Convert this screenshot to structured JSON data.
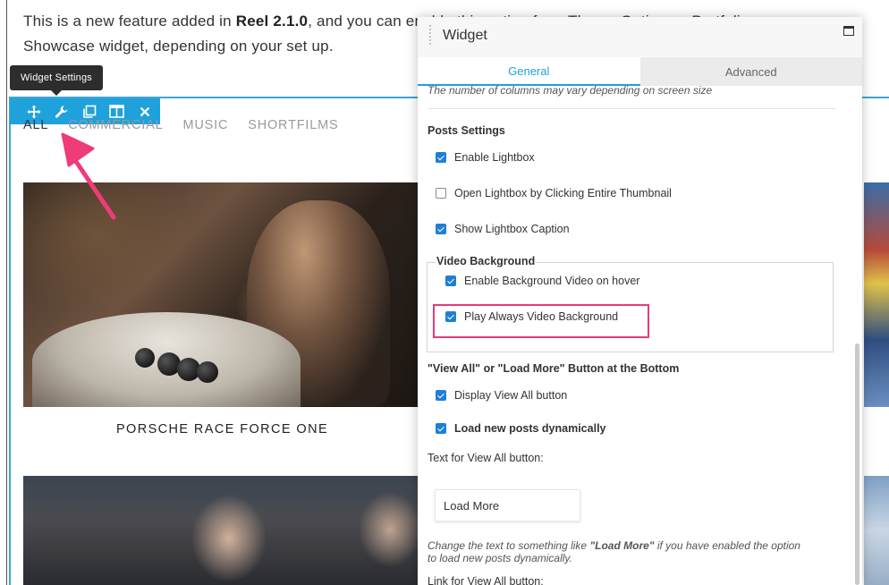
{
  "page": {
    "intro_part1": "This is a new feature added in ",
    "intro_bold": "Reel 2.1.0",
    "intro_part2": ", and you can enable this option from Theme Options » Portfolio",
    "intro_line2": "Showcase widget, depending on your set up."
  },
  "tooltip": "Widget Settings",
  "toolbar": {
    "buttons": [
      "move-icon",
      "wrench-icon",
      "duplicate-icon",
      "columns-icon",
      "close-icon"
    ],
    "accent": "#1fa1dc"
  },
  "filters": [
    "ALL",
    "COMMERCIAL",
    "MUSIC",
    "SHORTFILMS"
  ],
  "portfolio": {
    "caption1": "PORSCHE RACE FORCE ONE"
  },
  "panel": {
    "title": "Widget",
    "tabs": [
      "General",
      "Advanced"
    ],
    "columns_note": "The number of columns may vary depending on screen size",
    "posts_settings": {
      "heading": "Posts Settings",
      "enable_lightbox": "Enable Lightbox",
      "open_lightbox": "Open Lightbox by Clicking Entire Thumbnail",
      "show_caption": "Show Lightbox Caption"
    },
    "video_background": {
      "legend": "Video Background",
      "enable_hover": "Enable Background Video on hover",
      "play_always": "Play Always Video Background"
    },
    "view_all": {
      "heading": "\"View All\" or \"Load More\" Button at the Bottom",
      "display_button": "Display View All button",
      "load_dynamic": "Load new posts dynamically",
      "text_label": "Text for View All button:",
      "text_value": "Load More",
      "hint_part1": "Change the text to something like ",
      "hint_bold": "\"Load More\"",
      "hint_part2": " if you have enabled the option",
      "hint_line2": "to load new posts dynamically.",
      "link_label": "Link for View All button:"
    }
  },
  "colors": {
    "highlight": "#e33d77",
    "arrow": "#ef3b78",
    "checkbox": "#1f7fd6"
  }
}
